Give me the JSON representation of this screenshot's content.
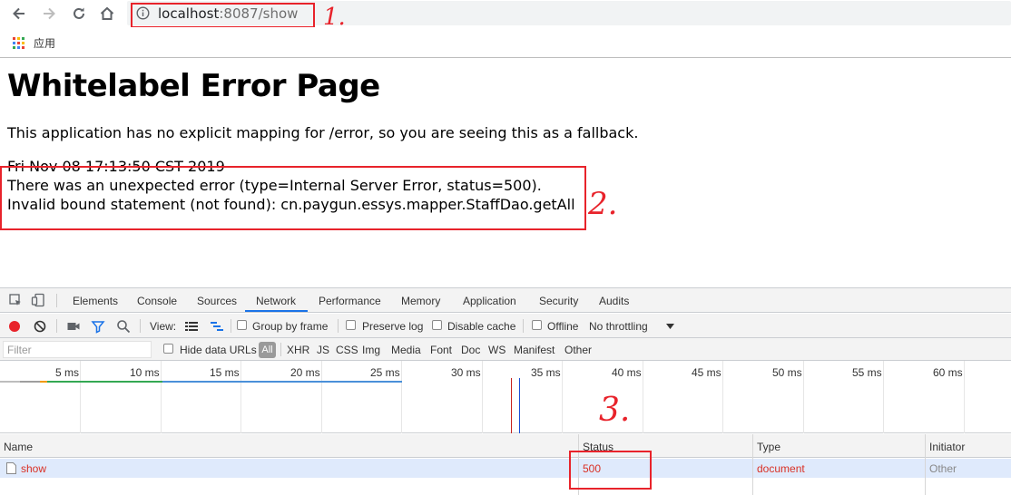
{
  "browser": {
    "url_host": "localhost",
    "url_rest": ":8087/show",
    "bookmarks": [
      {
        "label": "应用"
      }
    ]
  },
  "page": {
    "heading": "Whitelabel Error Page",
    "intro": "This application has no explicit mapping for /error, so you are seeing this as a fallback.",
    "timestamp": "Fri Nov 08 17:13:50 CST 2019",
    "error_line": "There was an unexpected error (type=Internal Server Error, status=500).",
    "detail_line": "Invalid bound statement (not found): cn.paygun.essys.mapper.StaffDao.getAll"
  },
  "annotations": {
    "mark_1": "1.",
    "mark_2": "2.",
    "mark_3": "3.",
    "color": "#e8232b"
  },
  "devtools": {
    "tabs": [
      "Elements",
      "Console",
      "Sources",
      "Network",
      "Performance",
      "Memory",
      "Application",
      "Security",
      "Audits"
    ],
    "active_tab": "Network",
    "toolbar": {
      "view_label": "View:",
      "group_by_frame": "Group by frame",
      "preserve_log": "Preserve log",
      "disable_cache": "Disable cache",
      "offline": "Offline",
      "throttling": "No throttling"
    },
    "filter": {
      "placeholder": "Filter",
      "hide_data_urls": "Hide data URLs",
      "types": [
        "All",
        "XHR",
        "JS",
        "CSS",
        "Img",
        "Media",
        "Font",
        "Doc",
        "WS",
        "Manifest",
        "Other"
      ]
    },
    "timeline_ticks": [
      "5 ms",
      "10 ms",
      "15 ms",
      "20 ms",
      "25 ms",
      "30 ms",
      "35 ms",
      "40 ms",
      "45 ms",
      "50 ms",
      "55 ms",
      "60 ms"
    ],
    "columns": [
      "Name",
      "Status",
      "Type",
      "Initiator"
    ],
    "requests": [
      {
        "name": "show",
        "status": "500",
        "type": "document",
        "initiator": "Other"
      }
    ],
    "colors": {
      "error_text": "#d93025",
      "selected_row": "#dfeafc",
      "accent": "#1a73e8"
    }
  }
}
